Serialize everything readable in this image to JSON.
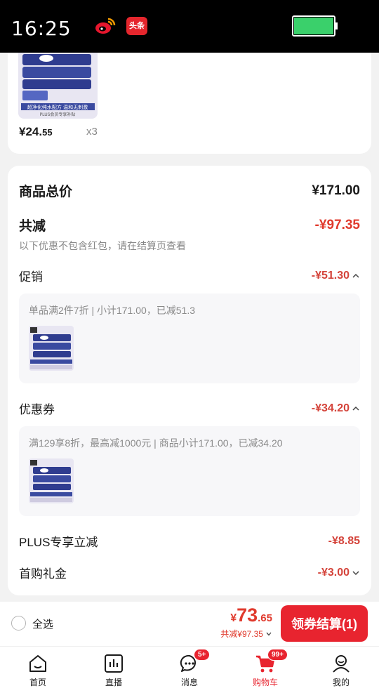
{
  "status_bar": {
    "time": "16:25",
    "toutiao_label": "头条"
  },
  "product": {
    "thumb_caption_1": "超净化纯水配方 温和无刺激",
    "thumb_caption_2": "PLUS会员专享补贴",
    "price_int": "¥24.",
    "price_dec": "55",
    "qty": "x3"
  },
  "summary": {
    "total_label": "商品总价",
    "total_value": "¥171.00",
    "reduce_label": "共减",
    "reduce_value": "-¥97.35",
    "note": "以下优惠不包含红包，请在结算页查看",
    "promo": {
      "label": "促销",
      "value": "-¥51.30",
      "detail": "单品满2件7折 | 小计171.00，已减51.3"
    },
    "coupon": {
      "label": "优惠券",
      "value": "-¥34.20",
      "detail": "满129享8折，最高减1000元 | 商品小计171.00，已减34.20"
    },
    "plus": {
      "label": "PLUS专享立减",
      "value": "-¥8.85"
    },
    "first": {
      "label": "首购礼金",
      "value": "-¥3.00"
    }
  },
  "checkout": {
    "select_all": "全选",
    "currency": "¥",
    "amount_int": "73",
    "amount_dec": ".65",
    "saved": "共减¥97.35",
    "button": "领券结算(1)"
  },
  "tabs": [
    {
      "label": "首页",
      "icon": "home-icon"
    },
    {
      "label": "直播",
      "icon": "live-chart-icon"
    },
    {
      "label": "消息",
      "icon": "message-icon",
      "badge": "5+"
    },
    {
      "label": "购物车",
      "icon": "cart-icon",
      "badge": "99+",
      "active": true
    },
    {
      "label": "我的",
      "icon": "profile-icon"
    }
  ],
  "colors": {
    "accent": "#e8242f",
    "discount": "#d4433a",
    "battery": "#3ad06b"
  }
}
